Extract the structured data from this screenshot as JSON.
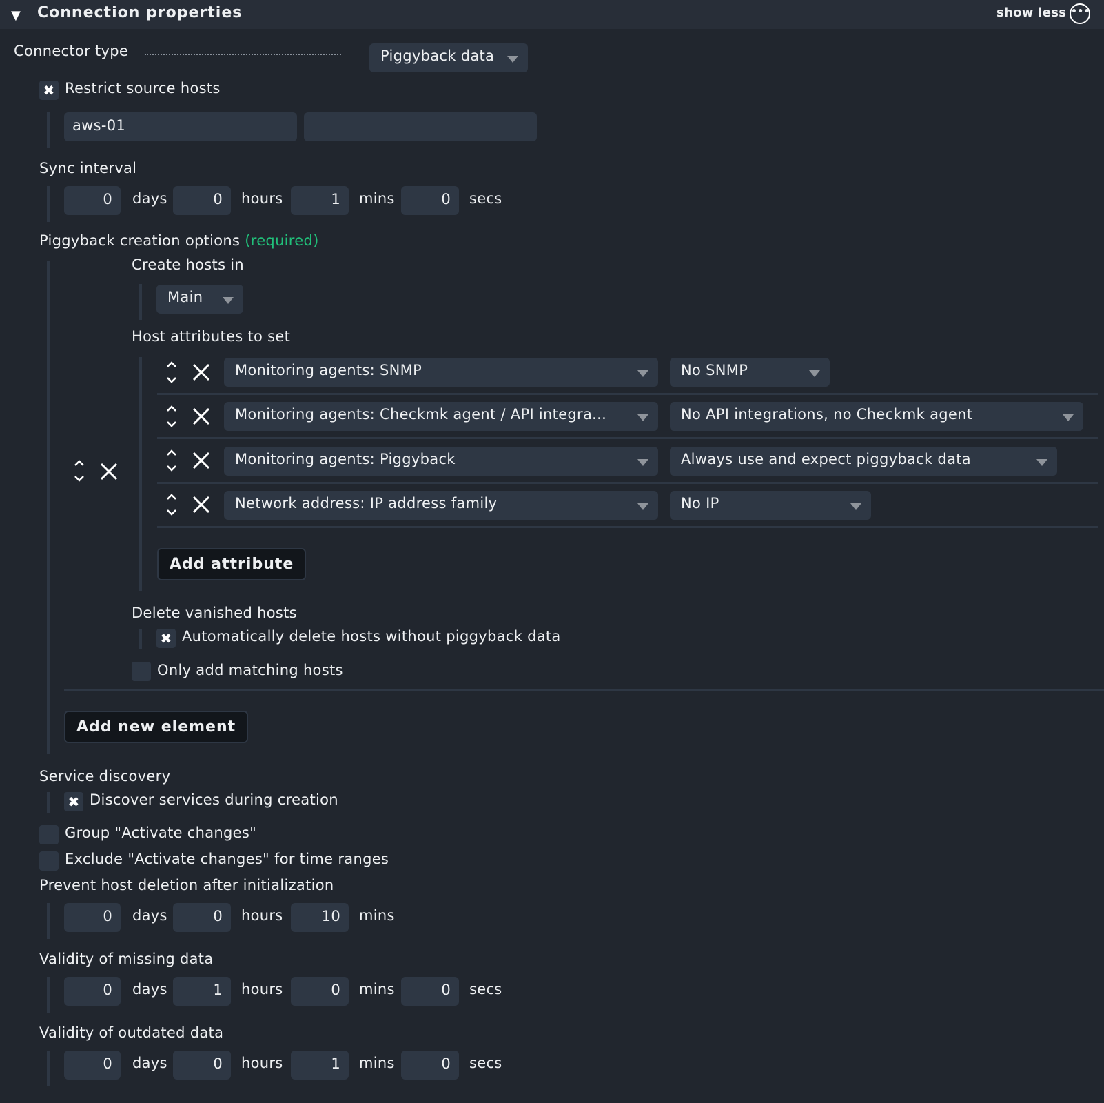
{
  "header": {
    "title": "Connection properties",
    "show_less": "show less",
    "collapse_icon": "triangle-down-icon",
    "more_icon": "ellipsis-circle-icon"
  },
  "connector_type": {
    "label": "Connector type",
    "value": "Piggyback data"
  },
  "restrict_source_hosts": {
    "label": "Restrict source hosts",
    "checked": true,
    "hosts": [
      "aws-01",
      ""
    ]
  },
  "sync_interval": {
    "label": "Sync interval",
    "days": "0",
    "hours": "0",
    "mins": "1",
    "secs": "0"
  },
  "units": {
    "days": "days",
    "hours": "hours",
    "mins": "mins",
    "secs": "secs"
  },
  "piggyback_creation": {
    "label": "Piggyback creation options",
    "required": "(required)",
    "create_hosts_in_label": "Create hosts in",
    "create_hosts_in_value": "Main",
    "host_attributes_label": "Host attributes to set",
    "attributes": [
      {
        "attribute": "Monitoring agents: SNMP",
        "value": "No SNMP"
      },
      {
        "attribute": "Monitoring agents: Checkmk agent / API integra...",
        "value": "No API integrations, no Checkmk agent"
      },
      {
        "attribute": "Monitoring agents: Piggyback",
        "value": "Always use and expect piggyback data"
      },
      {
        "attribute": "Network address: IP address family",
        "value": "No IP"
      }
    ],
    "add_attribute": "Add attribute",
    "delete_vanished_label": "Delete vanished hosts",
    "delete_vanished_checkbox": "Automatically delete hosts without piggyback data",
    "delete_vanished_checked": true,
    "only_matching": "Only add matching hosts",
    "only_matching_checked": false,
    "add_new_element": "Add new element"
  },
  "service_discovery": {
    "label": "Service discovery",
    "checkbox": "Discover services during creation",
    "checked": true
  },
  "group_activate": {
    "label": "Group \"Activate changes\"",
    "checked": false
  },
  "exclude_activate": {
    "label": "Exclude \"Activate changes\" for time ranges",
    "checked": false
  },
  "prevent_deletion": {
    "label": "Prevent host deletion after initialization",
    "days": "0",
    "hours": "0",
    "mins": "10"
  },
  "validity_missing": {
    "label": "Validity of missing data",
    "days": "0",
    "hours": "1",
    "mins": "0",
    "secs": "0"
  },
  "validity_outdated": {
    "label": "Validity of outdated data",
    "days": "0",
    "hours": "0",
    "mins": "1",
    "secs": "0"
  },
  "checkmark_glyph": "✖"
}
